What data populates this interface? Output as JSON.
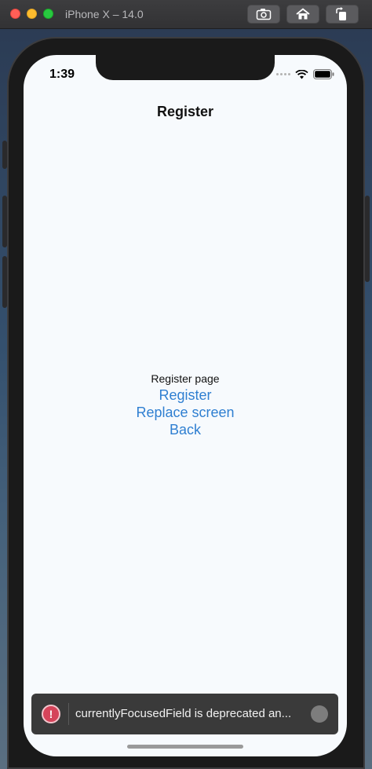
{
  "window": {
    "title": "iPhone X – 14.0"
  },
  "status_bar": {
    "time": "1:39"
  },
  "nav": {
    "title": "Register"
  },
  "content": {
    "page_label": "Register page",
    "links": [
      {
        "label": "Register"
      },
      {
        "label": "Replace screen"
      },
      {
        "label": "Back"
      }
    ]
  },
  "log_toast": {
    "message": "currentlyFocusedField is deprecated an...",
    "icon_glyph": "!"
  },
  "colors": {
    "link": "#2f7fd1",
    "screen_bg": "#f7fafd",
    "error": "#d5445a"
  },
  "icons": [
    "screenshot-icon",
    "home-icon",
    "rotate-icon",
    "wifi-icon",
    "battery-icon",
    "signal-dots-icon",
    "error-icon"
  ]
}
